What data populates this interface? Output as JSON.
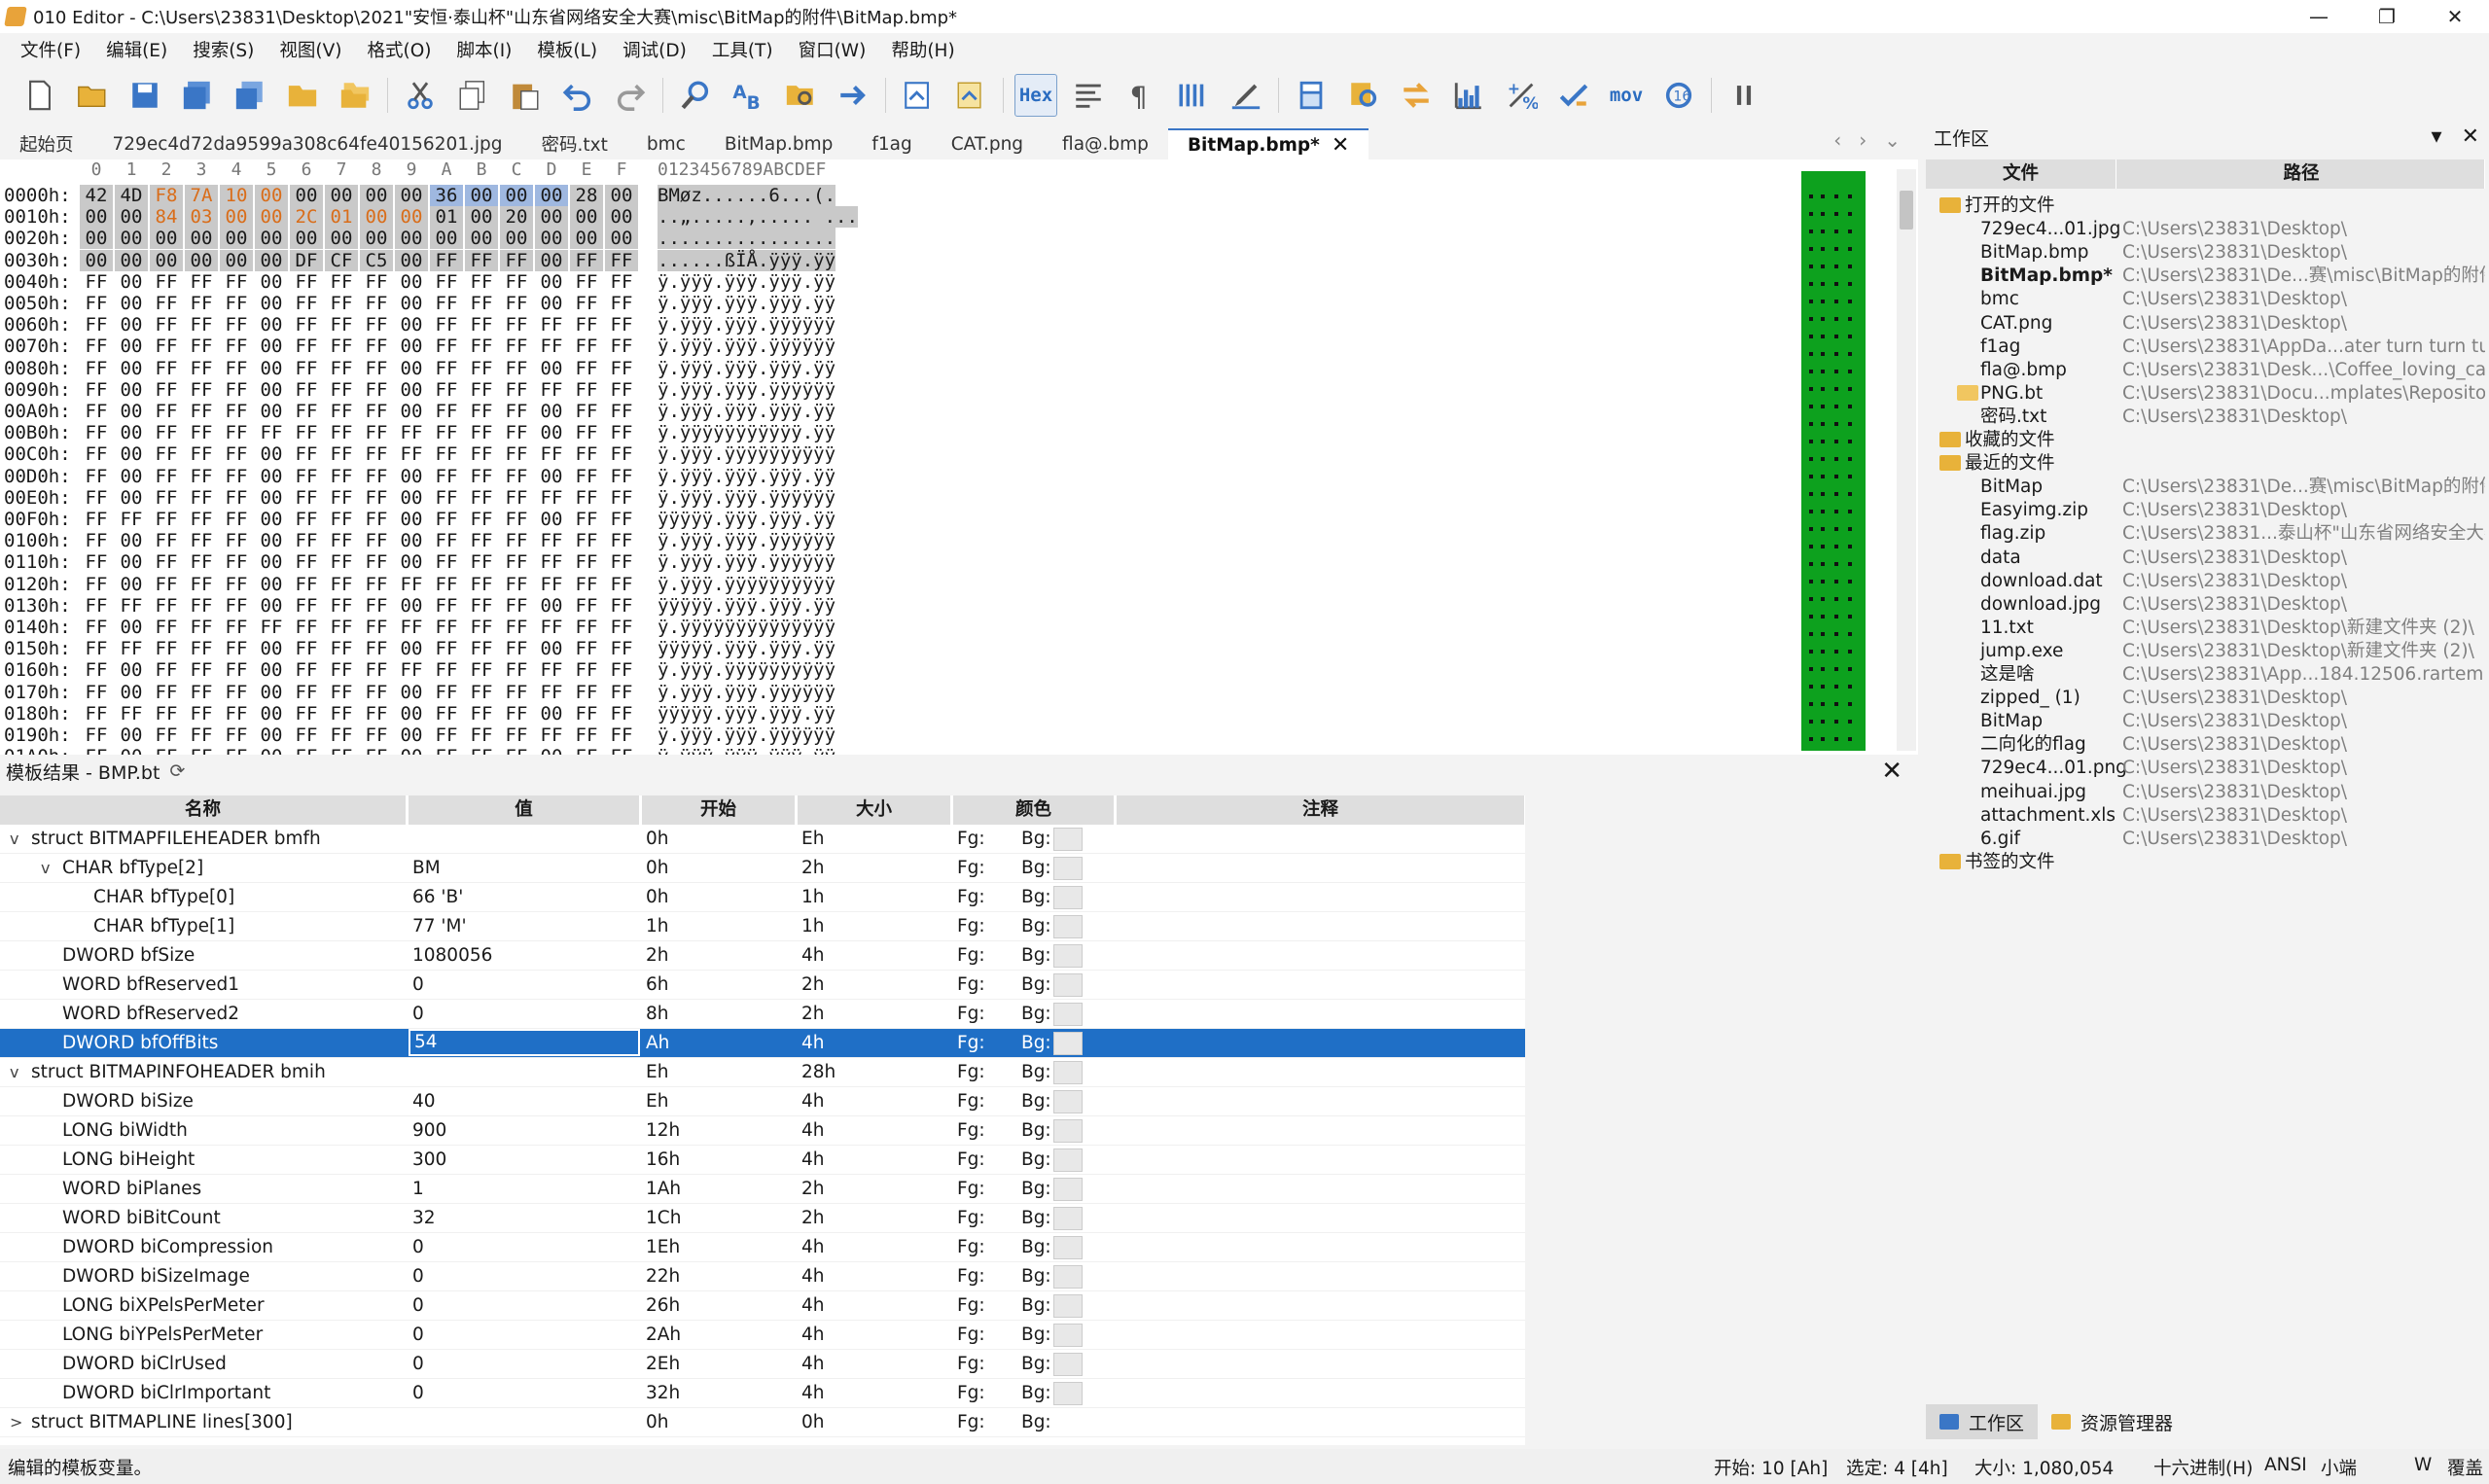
{
  "window": {
    "title": "010 Editor - C:\\Users\\23831\\Desktop\\2021\"安恒·泰山杯\"山东省网络安全大赛\\misc\\BitMap的附件\\BitMap.bmp*",
    "minimize": "—",
    "maximize": "❐",
    "close": "✕"
  },
  "menu": [
    "文件(F)",
    "编辑(E)",
    "搜索(S)",
    "视图(V)",
    "格式(O)",
    "脚本(I)",
    "模板(L)",
    "调试(D)",
    "工具(T)",
    "窗口(W)",
    "帮助(H)"
  ],
  "toolbar": {
    "hex_label": "Hex",
    "mov_label": "mov",
    "base_label": "10\n16"
  },
  "tabs": [
    {
      "label": "起始页"
    },
    {
      "label": "729ec4d72da9599a308c64fe40156201.jpg"
    },
    {
      "label": "密码.txt"
    },
    {
      "label": "bmc"
    },
    {
      "label": "BitMap.bmp"
    },
    {
      "label": "f1ag"
    },
    {
      "label": "CAT.png"
    },
    {
      "label": "fla@.bmp"
    },
    {
      "label": "BitMap.bmp*",
      "active": true
    }
  ],
  "tab_close": "✕",
  "hex": {
    "ruler_cols": [
      "0",
      "1",
      "2",
      "3",
      "4",
      "5",
      "6",
      "7",
      "8",
      "9",
      "A",
      "B",
      "C",
      "D",
      "E",
      "F"
    ],
    "ruler_ascii": "0123456789ABCDEF",
    "rows": [
      {
        "addr": "0000h:",
        "bytes": [
          "42",
          "4D",
          "F8",
          "7A",
          "10",
          "00",
          "00",
          "00",
          "00",
          "00",
          "36",
          "00",
          "00",
          "00",
          "28",
          "00"
        ],
        "ascii": "BMøz......6...(."
      },
      {
        "addr": "0010h:",
        "bytes": [
          "00",
          "00",
          "84",
          "03",
          "00",
          "00",
          "2C",
          "01",
          "00",
          "00",
          "01",
          "00",
          "20",
          "00",
          "00",
          "00"
        ],
        "ascii": "..„.....,..... ..."
      },
      {
        "addr": "0020h:",
        "bytes": [
          "00",
          "00",
          "00",
          "00",
          "00",
          "00",
          "00",
          "00",
          "00",
          "00",
          "00",
          "00",
          "00",
          "00",
          "00",
          "00"
        ],
        "ascii": "................"
      },
      {
        "addr": "0030h:",
        "bytes": [
          "00",
          "00",
          "00",
          "00",
          "00",
          "00",
          "DF",
          "CF",
          "C5",
          "00",
          "FF",
          "FF",
          "FF",
          "00",
          "FF",
          "FF"
        ],
        "ascii": "......ßÏÅ.ÿÿÿ.ÿÿ"
      },
      {
        "addr": "0040h:",
        "bytes": [
          "FF",
          "00",
          "FF",
          "FF",
          "FF",
          "00",
          "FF",
          "FF",
          "FF",
          "00",
          "FF",
          "FF",
          "FF",
          "00",
          "FF",
          "FF"
        ],
        "ascii": "ÿ.ÿÿÿ.ÿÿÿ.ÿÿÿ.ÿÿ"
      },
      {
        "addr": "0050h:",
        "bytes": [
          "FF",
          "00",
          "FF",
          "FF",
          "FF",
          "00",
          "FF",
          "FF",
          "FF",
          "00",
          "FF",
          "FF",
          "FF",
          "00",
          "FF",
          "FF"
        ],
        "ascii": "ÿ.ÿÿÿ.ÿÿÿ.ÿÿÿ.ÿÿ"
      },
      {
        "addr": "0060h:",
        "bytes": [
          "FF",
          "00",
          "FF",
          "FF",
          "FF",
          "00",
          "FF",
          "FF",
          "FF",
          "00",
          "FF",
          "FF",
          "FF",
          "FF",
          "FF",
          "FF"
        ],
        "ascii": "ÿ.ÿÿÿ.ÿÿÿ.ÿÿÿÿÿÿ"
      },
      {
        "addr": "0070h:",
        "bytes": [
          "FF",
          "00",
          "FF",
          "FF",
          "FF",
          "00",
          "FF",
          "FF",
          "FF",
          "00",
          "FF",
          "FF",
          "FF",
          "FF",
          "FF",
          "FF"
        ],
        "ascii": "ÿ.ÿÿÿ.ÿÿÿ.ÿÿÿÿÿÿ"
      },
      {
        "addr": "0080h:",
        "bytes": [
          "FF",
          "00",
          "FF",
          "FF",
          "FF",
          "00",
          "FF",
          "FF",
          "FF",
          "00",
          "FF",
          "FF",
          "FF",
          "00",
          "FF",
          "FF"
        ],
        "ascii": "ÿ.ÿÿÿ.ÿÿÿ.ÿÿÿ.ÿÿ"
      },
      {
        "addr": "0090h:",
        "bytes": [
          "FF",
          "00",
          "FF",
          "FF",
          "FF",
          "00",
          "FF",
          "FF",
          "FF",
          "00",
          "FF",
          "FF",
          "FF",
          "FF",
          "FF",
          "FF"
        ],
        "ascii": "ÿ.ÿÿÿ.ÿÿÿ.ÿÿÿÿÿÿ"
      },
      {
        "addr": "00A0h:",
        "bytes": [
          "FF",
          "00",
          "FF",
          "FF",
          "FF",
          "00",
          "FF",
          "FF",
          "FF",
          "00",
          "FF",
          "FF",
          "FF",
          "00",
          "FF",
          "FF"
        ],
        "ascii": "ÿ.ÿÿÿ.ÿÿÿ.ÿÿÿ.ÿÿ"
      },
      {
        "addr": "00B0h:",
        "bytes": [
          "FF",
          "00",
          "FF",
          "FF",
          "FF",
          "FF",
          "FF",
          "FF",
          "FF",
          "FF",
          "FF",
          "FF",
          "FF",
          "00",
          "FF",
          "FF"
        ],
        "ascii": "ÿ.ÿÿÿÿÿÿÿÿÿÿÿ.ÿÿ"
      },
      {
        "addr": "00C0h:",
        "bytes": [
          "FF",
          "00",
          "FF",
          "FF",
          "FF",
          "00",
          "FF",
          "FF",
          "FF",
          "FF",
          "FF",
          "FF",
          "FF",
          "FF",
          "FF",
          "FF"
        ],
        "ascii": "ÿ.ÿÿÿ.ÿÿÿÿÿÿÿÿÿÿ"
      },
      {
        "addr": "00D0h:",
        "bytes": [
          "FF",
          "00",
          "FF",
          "FF",
          "FF",
          "00",
          "FF",
          "FF",
          "FF",
          "00",
          "FF",
          "FF",
          "FF",
          "00",
          "FF",
          "FF"
        ],
        "ascii": "ÿ.ÿÿÿ.ÿÿÿ.ÿÿÿ.ÿÿ"
      },
      {
        "addr": "00E0h:",
        "bytes": [
          "FF",
          "00",
          "FF",
          "FF",
          "FF",
          "00",
          "FF",
          "FF",
          "FF",
          "00",
          "FF",
          "FF",
          "FF",
          "FF",
          "FF",
          "FF"
        ],
        "ascii": "ÿ.ÿÿÿ.ÿÿÿ.ÿÿÿÿÿÿ"
      },
      {
        "addr": "00F0h:",
        "bytes": [
          "FF",
          "FF",
          "FF",
          "FF",
          "FF",
          "00",
          "FF",
          "FF",
          "FF",
          "00",
          "FF",
          "FF",
          "FF",
          "00",
          "FF",
          "FF"
        ],
        "ascii": "ÿÿÿÿÿ.ÿÿÿ.ÿÿÿ.ÿÿ"
      },
      {
        "addr": "0100h:",
        "bytes": [
          "FF",
          "00",
          "FF",
          "FF",
          "FF",
          "00",
          "FF",
          "FF",
          "FF",
          "00",
          "FF",
          "FF",
          "FF",
          "FF",
          "FF",
          "FF"
        ],
        "ascii": "ÿ.ÿÿÿ.ÿÿÿ.ÿÿÿÿÿÿ"
      },
      {
        "addr": "0110h:",
        "bytes": [
          "FF",
          "00",
          "FF",
          "FF",
          "FF",
          "00",
          "FF",
          "FF",
          "FF",
          "00",
          "FF",
          "FF",
          "FF",
          "FF",
          "FF",
          "FF"
        ],
        "ascii": "ÿ.ÿÿÿ.ÿÿÿ.ÿÿÿÿÿÿ"
      },
      {
        "addr": "0120h:",
        "bytes": [
          "FF",
          "00",
          "FF",
          "FF",
          "FF",
          "00",
          "FF",
          "FF",
          "FF",
          "FF",
          "FF",
          "FF",
          "FF",
          "FF",
          "FF",
          "FF"
        ],
        "ascii": "ÿ.ÿÿÿ.ÿÿÿÿÿÿÿÿÿÿ"
      },
      {
        "addr": "0130h:",
        "bytes": [
          "FF",
          "FF",
          "FF",
          "FF",
          "FF",
          "00",
          "FF",
          "FF",
          "FF",
          "00",
          "FF",
          "FF",
          "FF",
          "00",
          "FF",
          "FF"
        ],
        "ascii": "ÿÿÿÿÿ.ÿÿÿ.ÿÿÿ.ÿÿ"
      },
      {
        "addr": "0140h:",
        "bytes": [
          "FF",
          "00",
          "FF",
          "FF",
          "FF",
          "FF",
          "FF",
          "FF",
          "FF",
          "FF",
          "FF",
          "FF",
          "FF",
          "FF",
          "FF",
          "FF"
        ],
        "ascii": "ÿ.ÿÿÿÿÿÿÿÿÿÿÿÿÿÿ"
      },
      {
        "addr": "0150h:",
        "bytes": [
          "FF",
          "FF",
          "FF",
          "FF",
          "FF",
          "00",
          "FF",
          "FF",
          "FF",
          "00",
          "FF",
          "FF",
          "FF",
          "00",
          "FF",
          "FF"
        ],
        "ascii": "ÿÿÿÿÿ.ÿÿÿ.ÿÿÿ.ÿÿ"
      },
      {
        "addr": "0160h:",
        "bytes": [
          "FF",
          "00",
          "FF",
          "FF",
          "FF",
          "00",
          "FF",
          "FF",
          "FF",
          "FF",
          "FF",
          "FF",
          "FF",
          "FF",
          "FF",
          "FF"
        ],
        "ascii": "ÿ.ÿÿÿ.ÿÿÿÿÿÿÿÿÿÿ"
      },
      {
        "addr": "0170h:",
        "bytes": [
          "FF",
          "00",
          "FF",
          "FF",
          "FF",
          "00",
          "FF",
          "FF",
          "FF",
          "00",
          "FF",
          "FF",
          "FF",
          "FF",
          "FF",
          "FF"
        ],
        "ascii": "ÿ.ÿÿÿ.ÿÿÿ.ÿÿÿÿÿÿ"
      },
      {
        "addr": "0180h:",
        "bytes": [
          "FF",
          "FF",
          "FF",
          "FF",
          "FF",
          "00",
          "FF",
          "FF",
          "FF",
          "00",
          "FF",
          "FF",
          "FF",
          "00",
          "FF",
          "FF"
        ],
        "ascii": "ÿÿÿÿÿ.ÿÿÿ.ÿÿÿ.ÿÿ"
      },
      {
        "addr": "0190h:",
        "bytes": [
          "FF",
          "00",
          "FF",
          "FF",
          "FF",
          "00",
          "FF",
          "FF",
          "FF",
          "00",
          "FF",
          "FF",
          "FF",
          "FF",
          "FF",
          "FF"
        ],
        "ascii": "ÿ.ÿÿÿ.ÿÿÿ.ÿÿÿÿÿÿ"
      },
      {
        "addr": "01A0h:",
        "bytes": [
          "FF",
          "00",
          "FF",
          "FF",
          "FF",
          "00",
          "FF",
          "FF",
          "FF",
          "00",
          "FF",
          "FF",
          "FF",
          "00",
          "FF",
          "FF"
        ],
        "ascii": "ÿ.ÿÿÿ.ÿÿÿ.ÿÿÿ.ÿÿ"
      }
    ]
  },
  "template": {
    "title": "模板结果 - BMP.bt",
    "close": "✕",
    "columns": [
      "名称",
      "值",
      "开始",
      "大小",
      "颜色",
      "注释"
    ],
    "rows": [
      {
        "indent": 0,
        "expander": "v",
        "name": "struct BITMAPFILEHEADER bmfh",
        "value": "",
        "start": "0h",
        "size": "Eh",
        "fg": "Fg:",
        "bg": "Bg:"
      },
      {
        "indent": 1,
        "expander": "v",
        "name": "CHAR bfType[2]",
        "value": "BM",
        "start": "0h",
        "size": "2h",
        "fg": "Fg:",
        "bg": "Bg:"
      },
      {
        "indent": 2,
        "expander": "",
        "name": "CHAR bfType[0]",
        "value": "66 'B'",
        "start": "0h",
        "size": "1h",
        "fg": "Fg:",
        "bg": "Bg:"
      },
      {
        "indent": 2,
        "expander": "",
        "name": "CHAR bfType[1]",
        "value": "77 'M'",
        "start": "1h",
        "size": "1h",
        "fg": "Fg:",
        "bg": "Bg:"
      },
      {
        "indent": 1,
        "expander": "",
        "name": "DWORD bfSize",
        "value": "1080056",
        "start": "2h",
        "size": "4h",
        "fg": "Fg:",
        "bg": "Bg:"
      },
      {
        "indent": 1,
        "expander": "",
        "name": "WORD bfReserved1",
        "value": "0",
        "start": "6h",
        "size": "2h",
        "fg": "Fg:",
        "bg": "Bg:"
      },
      {
        "indent": 1,
        "expander": "",
        "name": "WORD bfReserved2",
        "value": "0",
        "start": "8h",
        "size": "2h",
        "fg": "Fg:",
        "bg": "Bg:"
      },
      {
        "indent": 1,
        "expander": "",
        "name": "DWORD bfOffBits",
        "value": "54",
        "start": "Ah",
        "size": "4h",
        "fg": "Fg:",
        "bg": "Bg:",
        "selected": true
      },
      {
        "indent": 0,
        "expander": "v",
        "name": "struct BITMAPINFOHEADER bmih",
        "value": "",
        "start": "Eh",
        "size": "28h",
        "fg": "Fg:",
        "bg": "Bg:"
      },
      {
        "indent": 1,
        "expander": "",
        "name": "DWORD biSize",
        "value": "40",
        "start": "Eh",
        "size": "4h",
        "fg": "Fg:",
        "bg": "Bg:"
      },
      {
        "indent": 1,
        "expander": "",
        "name": "LONG biWidth",
        "value": "900",
        "start": "12h",
        "size": "4h",
        "fg": "Fg:",
        "bg": "Bg:"
      },
      {
        "indent": 1,
        "expander": "",
        "name": "LONG biHeight",
        "value": "300",
        "start": "16h",
        "size": "4h",
        "fg": "Fg:",
        "bg": "Bg:"
      },
      {
        "indent": 1,
        "expander": "",
        "name": "WORD biPlanes",
        "value": "1",
        "start": "1Ah",
        "size": "2h",
        "fg": "Fg:",
        "bg": "Bg:"
      },
      {
        "indent": 1,
        "expander": "",
        "name": "WORD biBitCount",
        "value": "32",
        "start": "1Ch",
        "size": "2h",
        "fg": "Fg:",
        "bg": "Bg:"
      },
      {
        "indent": 1,
        "expander": "",
        "name": "DWORD biCompression",
        "value": "0",
        "start": "1Eh",
        "size": "4h",
        "fg": "Fg:",
        "bg": "Bg:"
      },
      {
        "indent": 1,
        "expander": "",
        "name": "DWORD biSizeImage",
        "value": "0",
        "start": "22h",
        "size": "4h",
        "fg": "Fg:",
        "bg": "Bg:"
      },
      {
        "indent": 1,
        "expander": "",
        "name": "LONG biXPelsPerMeter",
        "value": "0",
        "start": "26h",
        "size": "4h",
        "fg": "Fg:",
        "bg": "Bg:"
      },
      {
        "indent": 1,
        "expander": "",
        "name": "LONG biYPelsPerMeter",
        "value": "0",
        "start": "2Ah",
        "size": "4h",
        "fg": "Fg:",
        "bg": "Bg:"
      },
      {
        "indent": 1,
        "expander": "",
        "name": "DWORD biClrUsed",
        "value": "0",
        "start": "2Eh",
        "size": "4h",
        "fg": "Fg:",
        "bg": "Bg:"
      },
      {
        "indent": 1,
        "expander": "",
        "name": "DWORD biClrImportant",
        "value": "0",
        "start": "32h",
        "size": "4h",
        "fg": "Fg:",
        "bg": "Bg:"
      },
      {
        "indent": 0,
        "expander": ">",
        "name": "struct BITMAPLINE lines[300]",
        "value": "",
        "start": "0h",
        "size": "0h",
        "fg": "Fg:",
        "bg": "Bg:",
        "noswatch": true
      }
    ]
  },
  "workspace": {
    "title": "工作区",
    "col_file": "文件",
    "col_path": "路径",
    "items": [
      {
        "type": "group",
        "name": "打开的文件"
      },
      {
        "type": "file",
        "name": "729ec4...01.jpg",
        "path": "C:\\Users\\23831\\Desktop\\"
      },
      {
        "type": "file",
        "name": "BitMap.bmp",
        "path": "C:\\Users\\23831\\Desktop\\"
      },
      {
        "type": "file",
        "name": "BitMap.bmp*",
        "path": "C:\\Users\\23831\\De...赛\\misc\\BitMap的附件\\",
        "bold": true
      },
      {
        "type": "file",
        "name": "bmc",
        "path": "C:\\Users\\23831\\Desktop\\"
      },
      {
        "type": "file",
        "name": "CAT.png",
        "path": "C:\\Users\\23831\\Desktop\\"
      },
      {
        "type": "file",
        "name": "f1ag",
        "path": "C:\\Users\\23831\\AppDa...ater turn turn turn\\"
      },
      {
        "type": "file",
        "name": "fla@.bmp",
        "path": "C:\\Users\\23831\\Desk...\\Coffee_loving_cat\\"
      },
      {
        "type": "file",
        "name": "PNG.bt",
        "path": "C:\\Users\\23831\\Docu...mplates\\Repository\\",
        "icon": true
      },
      {
        "type": "file",
        "name": "密码.txt",
        "path": "C:\\Users\\23831\\Desktop\\"
      },
      {
        "type": "group",
        "name": "收藏的文件"
      },
      {
        "type": "group",
        "name": "最近的文件"
      },
      {
        "type": "file",
        "name": "BitMap",
        "path": "C:\\Users\\23831\\De...赛\\misc\\BitMap的附件\\"
      },
      {
        "type": "file",
        "name": "Easyimg.zip",
        "path": "C:\\Users\\23831\\Desktop\\"
      },
      {
        "type": "file",
        "name": "flag.zip",
        "path": "C:\\Users\\23831...泰山杯\"山东省网络安全大赛\\"
      },
      {
        "type": "file",
        "name": "data",
        "path": "C:\\Users\\23831\\Desktop\\"
      },
      {
        "type": "file",
        "name": "download.dat",
        "path": "C:\\Users\\23831\\Desktop\\"
      },
      {
        "type": "file",
        "name": "download.jpg",
        "path": "C:\\Users\\23831\\Desktop\\"
      },
      {
        "type": "file",
        "name": "11.txt",
        "path": "C:\\Users\\23831\\Desktop\\新建文件夹 (2)\\"
      },
      {
        "type": "file",
        "name": "jump.exe",
        "path": "C:\\Users\\23831\\Desktop\\新建文件夹 (2)\\"
      },
      {
        "type": "file",
        "name": "这是啥",
        "path": "C:\\Users\\23831\\App...184.12506.rartemp\\"
      },
      {
        "type": "file",
        "name": "zipped_ (1)",
        "path": "C:\\Users\\23831\\Desktop\\"
      },
      {
        "type": "file",
        "name": "BitMap",
        "path": "C:\\Users\\23831\\Desktop\\"
      },
      {
        "type": "file",
        "name": "二向化的flag",
        "path": "C:\\Users\\23831\\Desktop\\"
      },
      {
        "type": "file",
        "name": "729ec4...01.png",
        "path": "C:\\Users\\23831\\Desktop\\"
      },
      {
        "type": "file",
        "name": "meihuai.jpg",
        "path": "C:\\Users\\23831\\Desktop\\"
      },
      {
        "type": "file",
        "name": "attachment.xls",
        "path": "C:\\Users\\23831\\Desktop\\"
      },
      {
        "type": "file",
        "name": "6.gif",
        "path": "C:\\Users\\23831\\Desktop\\"
      },
      {
        "type": "group",
        "name": "书签的文件"
      }
    ],
    "bottom_tabs": [
      "工作区",
      "资源管理器"
    ]
  },
  "status": {
    "left": "编辑的模板变量。",
    "start": "开始: 10 [Ah]",
    "selection": "选定: 4 [4h]",
    "size": "大小: 1,080,054",
    "base": "十六进制(H)",
    "encoding": "ANSI",
    "endian": "小端",
    "mode_w": "W",
    "mode_ovr": "覆盖"
  },
  "colors": {
    "accent": "#1f6fc6",
    "minimap": "#0da11e",
    "orange": "#d96d1a"
  }
}
